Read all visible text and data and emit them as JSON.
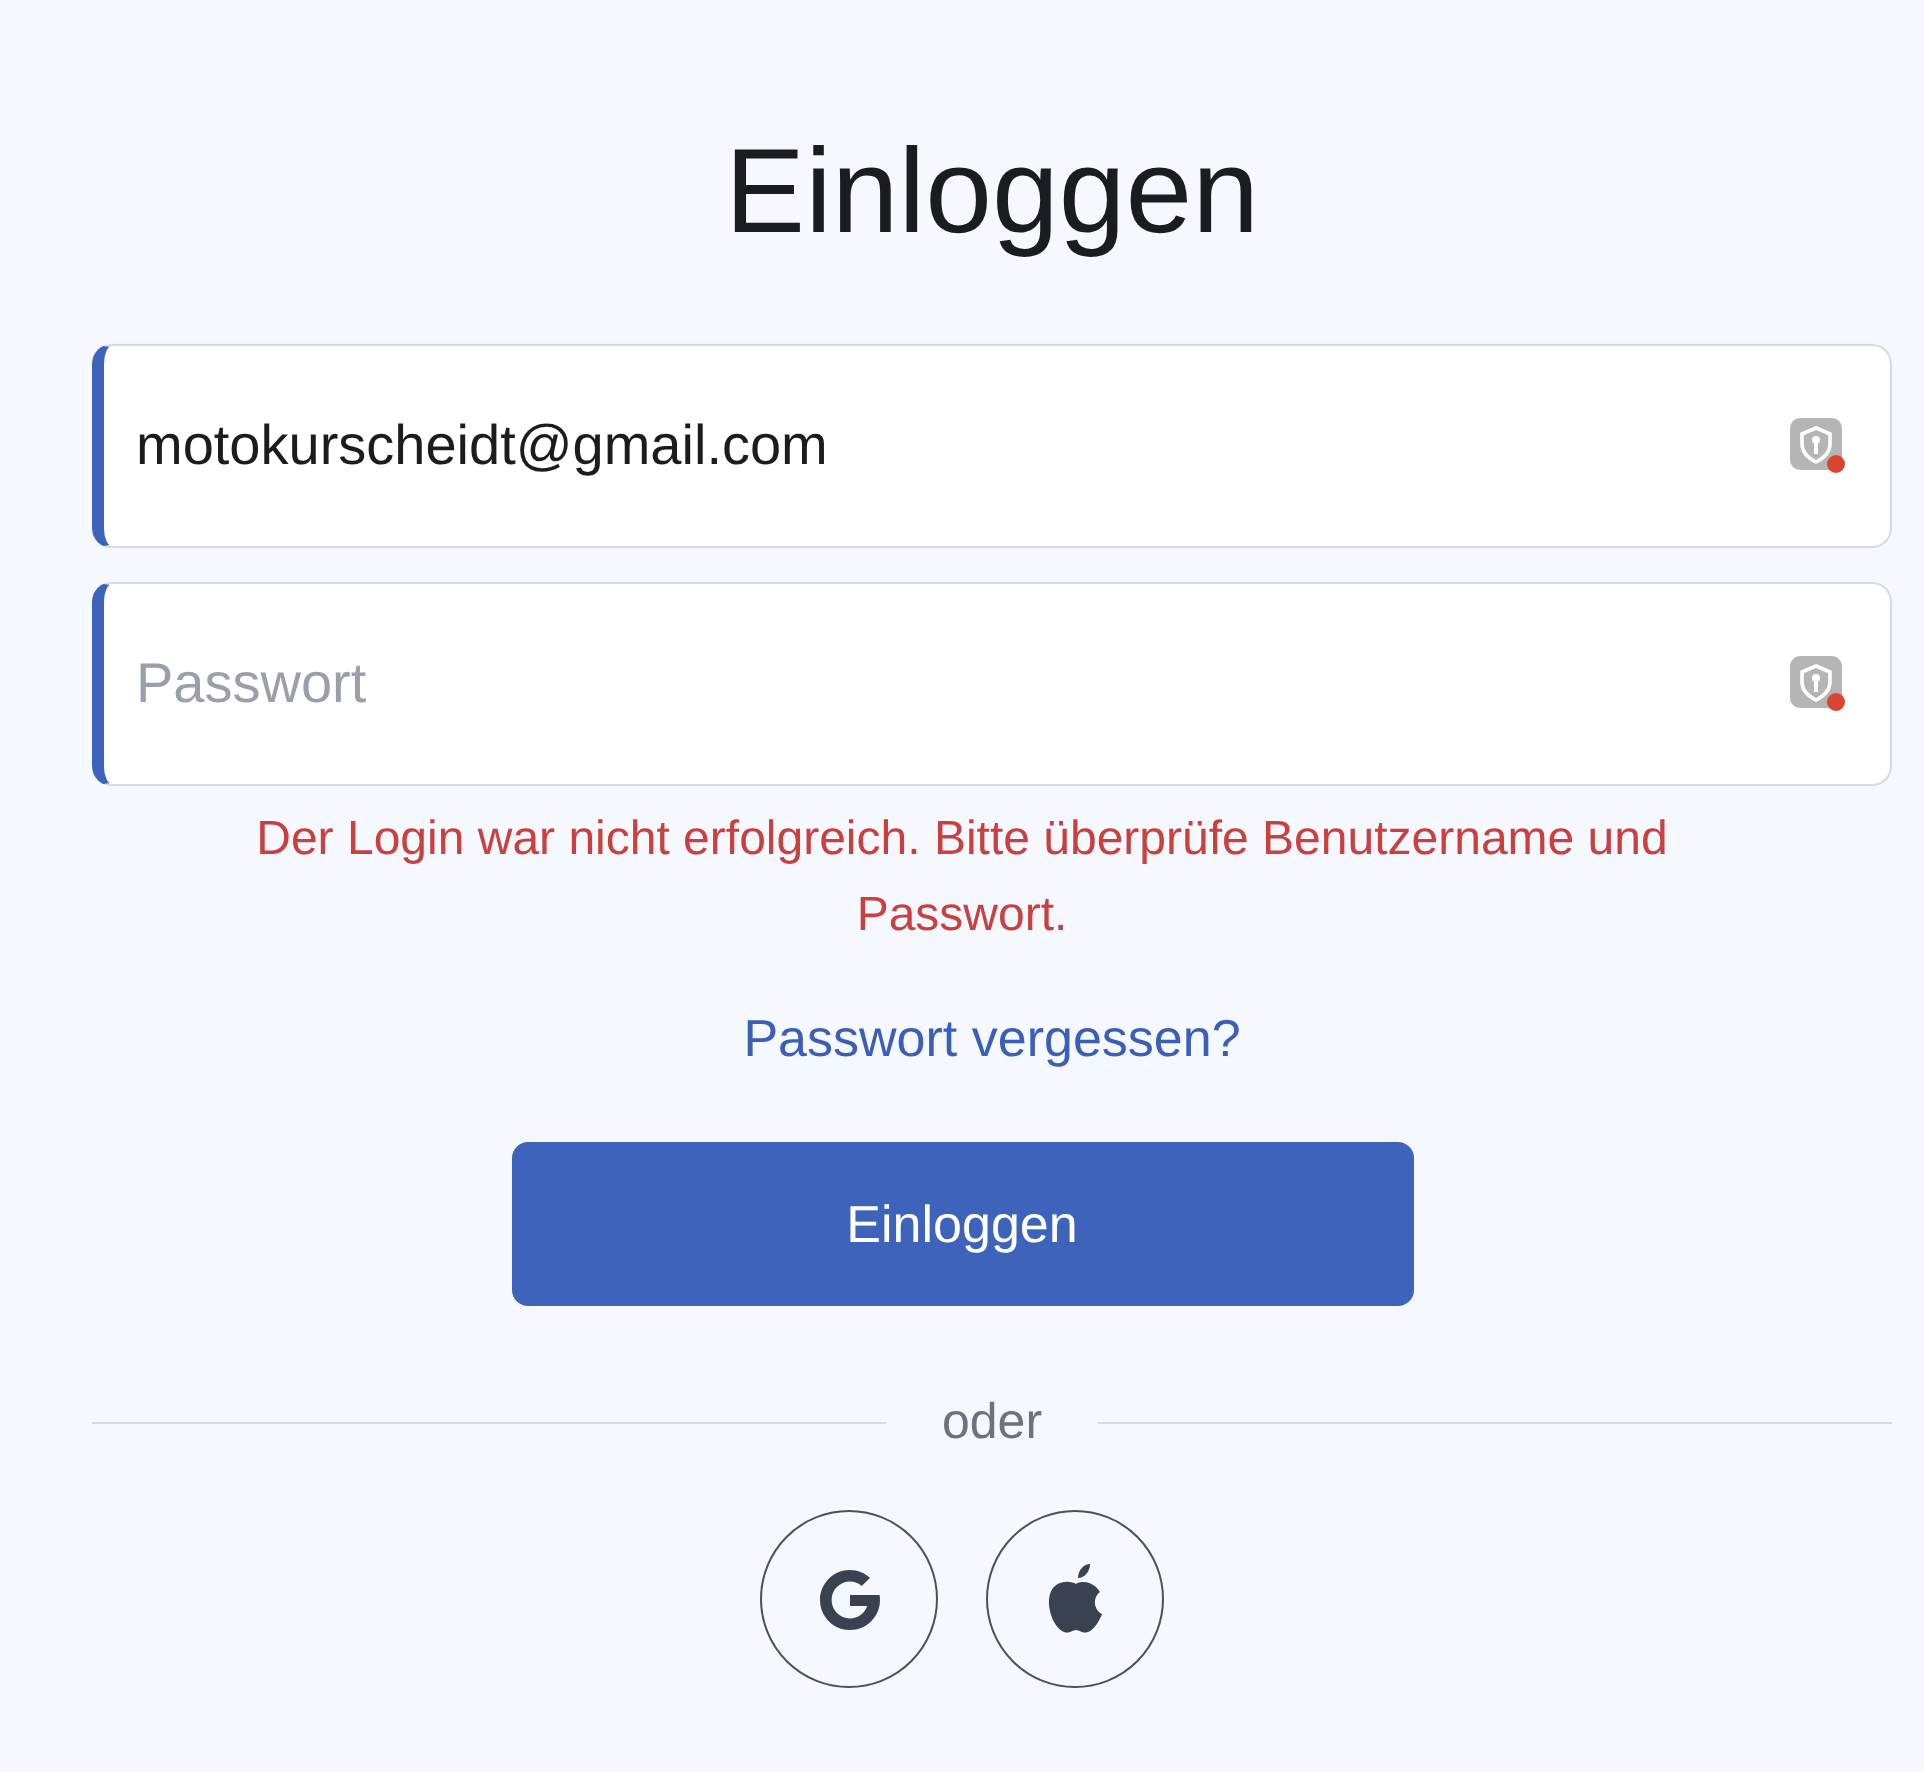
{
  "title": "Einloggen",
  "fields": [
    {
      "kind": "email",
      "value": "motokurscheidt@gmail.com"
    },
    {
      "kind": "password",
      "placeholder": "Passwort"
    }
  ],
  "error": "Der Login war nicht erfolgreich. Bitte überprüfe Benutzername und Passwort.",
  "forgot_link": "Passwort vergessen?",
  "submit_button": "Einloggen",
  "divider": "oder",
  "social_buttons": [
    {
      "kind": "google"
    },
    {
      "kind": "apple"
    }
  ]
}
